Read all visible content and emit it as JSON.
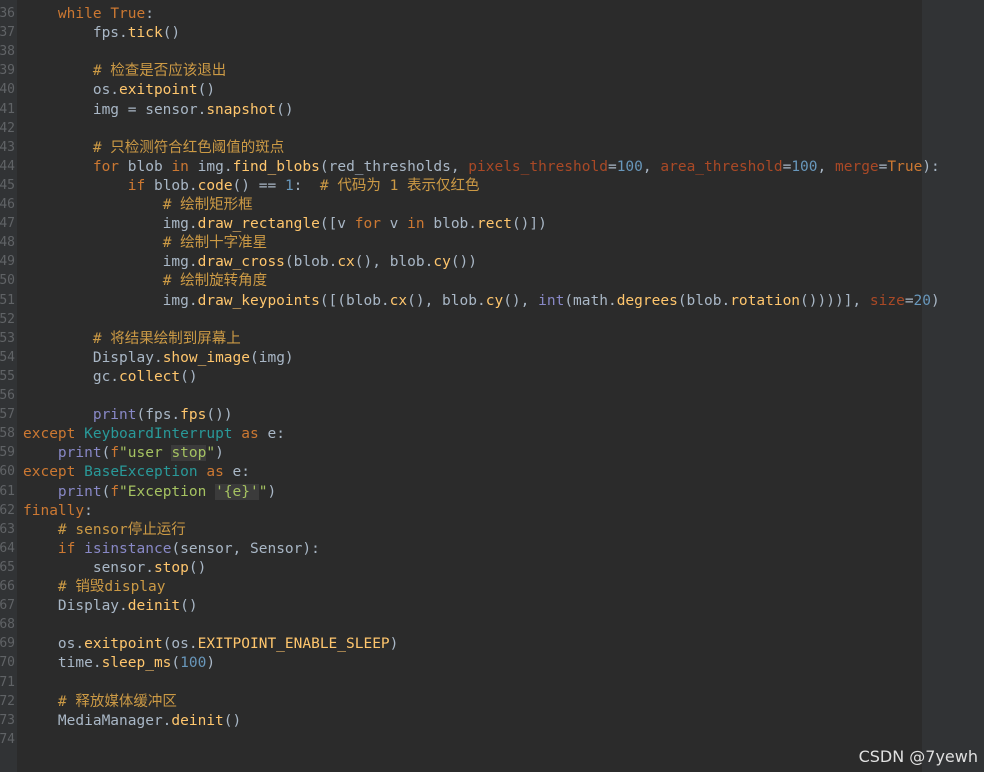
{
  "editor": {
    "lines": [
      {
        "num": "36",
        "segs": [
          [
            "",
            "    "
          ],
          [
            "kw",
            "while"
          ],
          [
            "",
            " "
          ],
          [
            "kw",
            "True"
          ],
          [
            "",
            ":"
          ]
        ]
      },
      {
        "num": "37",
        "segs": [
          [
            "",
            "        fps."
          ],
          [
            "fn",
            "tick"
          ],
          [
            "",
            "()"
          ]
        ]
      },
      {
        "num": "38",
        "segs": [
          [
            "",
            ""
          ]
        ]
      },
      {
        "num": "39",
        "segs": [
          [
            "",
            "        "
          ],
          [
            "comment",
            "# 检查是否应该退出"
          ]
        ]
      },
      {
        "num": "40",
        "segs": [
          [
            "",
            "        os."
          ],
          [
            "fn",
            "exitpoint"
          ],
          [
            "",
            "()"
          ]
        ]
      },
      {
        "num": "41",
        "segs": [
          [
            "",
            "        img = sensor."
          ],
          [
            "fn",
            "snapshot"
          ],
          [
            "",
            "()"
          ]
        ]
      },
      {
        "num": "42",
        "segs": [
          [
            "",
            ""
          ]
        ]
      },
      {
        "num": "43",
        "segs": [
          [
            "",
            "        "
          ],
          [
            "comment",
            "# 只检测符合红色阈值的斑点"
          ]
        ]
      },
      {
        "num": "44",
        "segs": [
          [
            "",
            "        "
          ],
          [
            "kw",
            "for"
          ],
          [
            "",
            " blob "
          ],
          [
            "kw",
            "in"
          ],
          [
            "",
            " img."
          ],
          [
            "fn",
            "find_blobs"
          ],
          [
            "",
            "(red_thresholds, "
          ],
          [
            "pm",
            "pixels_threshold"
          ],
          [
            "",
            "="
          ],
          [
            "num",
            "100"
          ],
          [
            "",
            ", "
          ],
          [
            "pm",
            "area_threshold"
          ],
          [
            "",
            "="
          ],
          [
            "num",
            "100"
          ],
          [
            "",
            ", "
          ],
          [
            "pm",
            "merge"
          ],
          [
            "",
            "="
          ],
          [
            "kw",
            "True"
          ],
          [
            "",
            "):"
          ]
        ]
      },
      {
        "num": "45",
        "segs": [
          [
            "",
            "            "
          ],
          [
            "kw",
            "if"
          ],
          [
            "",
            " blob."
          ],
          [
            "fn",
            "code"
          ],
          [
            "",
            "() == "
          ],
          [
            "num",
            "1"
          ],
          [
            "",
            ":  "
          ],
          [
            "comment",
            "# 代码为 1 表示仅红色"
          ]
        ]
      },
      {
        "num": "46",
        "segs": [
          [
            "",
            "                "
          ],
          [
            "comment",
            "# 绘制矩形框"
          ]
        ]
      },
      {
        "num": "47",
        "segs": [
          [
            "",
            "                img."
          ],
          [
            "fn",
            "draw_rectangle"
          ],
          [
            "",
            "([v "
          ],
          [
            "kw",
            "for"
          ],
          [
            "",
            " v "
          ],
          [
            "kw",
            "in"
          ],
          [
            "",
            " blob."
          ],
          [
            "fn",
            "rect"
          ],
          [
            "",
            "()])"
          ]
        ]
      },
      {
        "num": "48",
        "segs": [
          [
            "",
            "                "
          ],
          [
            "comment",
            "# 绘制十字准星"
          ]
        ]
      },
      {
        "num": "49",
        "segs": [
          [
            "",
            "                img."
          ],
          [
            "fn",
            "draw_cross"
          ],
          [
            "",
            "(blob."
          ],
          [
            "fn",
            "cx"
          ],
          [
            "",
            "(), blob."
          ],
          [
            "fn",
            "cy"
          ],
          [
            "",
            "())"
          ]
        ]
      },
      {
        "num": "50",
        "segs": [
          [
            "",
            "                "
          ],
          [
            "comment",
            "# 绘制旋转角度"
          ]
        ]
      },
      {
        "num": "51",
        "segs": [
          [
            "",
            "                img."
          ],
          [
            "fn",
            "draw_keypoints"
          ],
          [
            "",
            "([(blob."
          ],
          [
            "fn",
            "cx"
          ],
          [
            "",
            "(), blob."
          ],
          [
            "fn",
            "cy"
          ],
          [
            "",
            "(), "
          ],
          [
            "blt",
            "int"
          ],
          [
            "",
            "(math."
          ],
          [
            "fn",
            "degrees"
          ],
          [
            "",
            "(blob."
          ],
          [
            "fn",
            "rotation"
          ],
          [
            "",
            "())))], "
          ],
          [
            "pm",
            "size"
          ],
          [
            "",
            "="
          ],
          [
            "num",
            "20"
          ],
          [
            "",
            ")"
          ]
        ]
      },
      {
        "num": "52",
        "segs": [
          [
            "",
            ""
          ]
        ]
      },
      {
        "num": "53",
        "segs": [
          [
            "",
            "        "
          ],
          [
            "comment",
            "# 将结果绘制到屏幕上"
          ]
        ]
      },
      {
        "num": "54",
        "segs": [
          [
            "",
            "        Display."
          ],
          [
            "fn",
            "show_image"
          ],
          [
            "",
            "(img)"
          ]
        ]
      },
      {
        "num": "55",
        "segs": [
          [
            "",
            "        gc."
          ],
          [
            "fn",
            "collect"
          ],
          [
            "",
            "()"
          ]
        ]
      },
      {
        "num": "56",
        "segs": [
          [
            "",
            ""
          ]
        ]
      },
      {
        "num": "57",
        "segs": [
          [
            "",
            "        "
          ],
          [
            "blt",
            "print"
          ],
          [
            "",
            "(fps."
          ],
          [
            "fn",
            "fps"
          ],
          [
            "",
            "())"
          ]
        ]
      },
      {
        "num": "58",
        "segs": [
          [
            "kw",
            "except"
          ],
          [
            "",
            " "
          ],
          [
            "cyan",
            "KeyboardInterrupt"
          ],
          [
            "",
            " "
          ],
          [
            "kw",
            "as"
          ],
          [
            "",
            " e:"
          ]
        ]
      },
      {
        "num": "59",
        "segs": [
          [
            "",
            "    "
          ],
          [
            "blt",
            "print"
          ],
          [
            "",
            "("
          ],
          [
            "kw",
            "f"
          ],
          [
            "str",
            "\"user "
          ],
          [
            "hlstr",
            "stop"
          ],
          [
            "str",
            "\""
          ],
          [
            "",
            ")"
          ]
        ]
      },
      {
        "num": "60",
        "segs": [
          [
            "kw",
            "except"
          ],
          [
            "",
            " "
          ],
          [
            "cyan",
            "BaseException"
          ],
          [
            "",
            " "
          ],
          [
            "kw",
            "as"
          ],
          [
            "",
            " e:"
          ]
        ]
      },
      {
        "num": "61",
        "segs": [
          [
            "",
            "    "
          ],
          [
            "blt",
            "print"
          ],
          [
            "",
            "("
          ],
          [
            "kw",
            "f"
          ],
          [
            "str",
            "\"Exception "
          ],
          [
            "hlstr",
            "'{e}'"
          ],
          [
            "str",
            "\""
          ],
          [
            "",
            ")"
          ]
        ]
      },
      {
        "num": "62",
        "segs": [
          [
            "kw",
            "finally"
          ],
          [
            "",
            ":"
          ]
        ]
      },
      {
        "num": "63",
        "segs": [
          [
            "",
            "    "
          ],
          [
            "comment",
            "# sensor停止运行"
          ]
        ]
      },
      {
        "num": "64",
        "segs": [
          [
            "",
            "    "
          ],
          [
            "kw",
            "if"
          ],
          [
            "",
            " "
          ],
          [
            "blt",
            "isinstance"
          ],
          [
            "",
            "(sensor, Sensor):"
          ]
        ]
      },
      {
        "num": "65",
        "segs": [
          [
            "",
            "        sensor."
          ],
          [
            "fn",
            "stop"
          ],
          [
            "",
            "()"
          ]
        ]
      },
      {
        "num": "66",
        "segs": [
          [
            "",
            "    "
          ],
          [
            "comment",
            "# 销毁display"
          ]
        ]
      },
      {
        "num": "67",
        "segs": [
          [
            "",
            "    Display."
          ],
          [
            "fn",
            "deinit"
          ],
          [
            "",
            "()"
          ]
        ]
      },
      {
        "num": "68",
        "segs": [
          [
            "",
            ""
          ]
        ]
      },
      {
        "num": "69",
        "segs": [
          [
            "",
            "    os."
          ],
          [
            "fn",
            "exitpoint"
          ],
          [
            "",
            "(os."
          ],
          [
            "fn",
            "EXITPOINT_ENABLE_SLEEP"
          ],
          [
            "",
            ")"
          ]
        ]
      },
      {
        "num": "70",
        "segs": [
          [
            "",
            "    time."
          ],
          [
            "fn",
            "sleep_ms"
          ],
          [
            "",
            "("
          ],
          [
            "num",
            "100"
          ],
          [
            "",
            ")"
          ]
        ]
      },
      {
        "num": "71",
        "segs": [
          [
            "",
            ""
          ]
        ]
      },
      {
        "num": "72",
        "segs": [
          [
            "",
            "    "
          ],
          [
            "comment",
            "# 释放媒体缓冲区"
          ]
        ]
      },
      {
        "num": "73",
        "segs": [
          [
            "",
            "    MediaManager."
          ],
          [
            "fn",
            "deinit"
          ],
          [
            "",
            "()"
          ]
        ]
      },
      {
        "num": "74",
        "segs": [
          [
            "",
            ""
          ]
        ]
      }
    ]
  },
  "watermark": "CSDN @7yewh"
}
